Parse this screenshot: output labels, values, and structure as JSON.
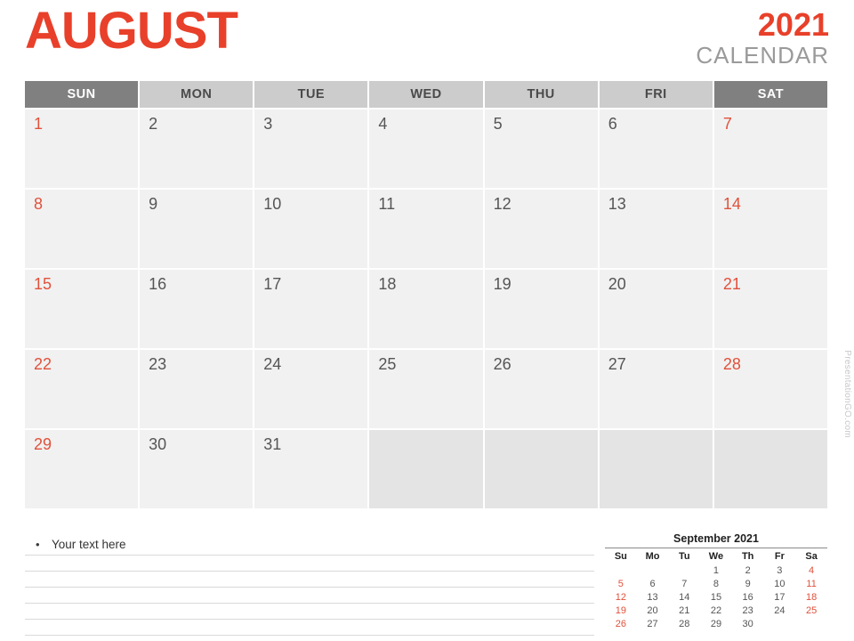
{
  "header": {
    "month": "AUGUST",
    "year": "2021",
    "calendar_word": "CALENDAR",
    "month_color": "#E8402A",
    "year_color": "#E8402A",
    "calendar_word_color": "#9A9A9A"
  },
  "colors": {
    "accent_red": "#E8402A",
    "date_red": "#E0513B",
    "header_weekend_bg": "#808080",
    "header_weekday_bg": "#CCCCCC",
    "day_cell_bg": "#F1F1F1",
    "empty_cell_bg": "#E4E4E4",
    "day_num": "#555555"
  },
  "weekdays": [
    {
      "label": "SUN",
      "weekend": true
    },
    {
      "label": "MON",
      "weekend": false
    },
    {
      "label": "TUE",
      "weekend": false
    },
    {
      "label": "WED",
      "weekend": false
    },
    {
      "label": "THU",
      "weekend": false
    },
    {
      "label": "FRI",
      "weekend": false
    },
    {
      "label": "SAT",
      "weekend": true
    }
  ],
  "weeks": [
    [
      {
        "day": "1",
        "weekend": true
      },
      {
        "day": "2",
        "weekend": false
      },
      {
        "day": "3",
        "weekend": false
      },
      {
        "day": "4",
        "weekend": false
      },
      {
        "day": "5",
        "weekend": false
      },
      {
        "day": "6",
        "weekend": false
      },
      {
        "day": "7",
        "weekend": true
      }
    ],
    [
      {
        "day": "8",
        "weekend": true
      },
      {
        "day": "9",
        "weekend": false
      },
      {
        "day": "10",
        "weekend": false
      },
      {
        "day": "11",
        "weekend": false
      },
      {
        "day": "12",
        "weekend": false
      },
      {
        "day": "13",
        "weekend": false
      },
      {
        "day": "14",
        "weekend": true
      }
    ],
    [
      {
        "day": "15",
        "weekend": true
      },
      {
        "day": "16",
        "weekend": false
      },
      {
        "day": "17",
        "weekend": false
      },
      {
        "day": "18",
        "weekend": false
      },
      {
        "day": "19",
        "weekend": false
      },
      {
        "day": "20",
        "weekend": false
      },
      {
        "day": "21",
        "weekend": true
      }
    ],
    [
      {
        "day": "22",
        "weekend": true
      },
      {
        "day": "23",
        "weekend": false
      },
      {
        "day": "24",
        "weekend": false
      },
      {
        "day": "25",
        "weekend": false
      },
      {
        "day": "26",
        "weekend": false
      },
      {
        "day": "27",
        "weekend": false
      },
      {
        "day": "28",
        "weekend": true
      }
    ],
    [
      {
        "day": "29",
        "weekend": true
      },
      {
        "day": "30",
        "weekend": false
      },
      {
        "day": "31",
        "weekend": false
      },
      {
        "day": "",
        "weekend": false
      },
      {
        "day": "",
        "weekend": false
      },
      {
        "day": "",
        "weekend": false
      },
      {
        "day": "",
        "weekend": true
      }
    ]
  ],
  "notes": {
    "bullet": "•",
    "text": "Your text here",
    "line_count": 6
  },
  "mini_calendar": {
    "title": "September 2021",
    "weekdays": [
      {
        "label": "Su",
        "weekend": true
      },
      {
        "label": "Mo",
        "weekend": false
      },
      {
        "label": "Tu",
        "weekend": false
      },
      {
        "label": "We",
        "weekend": false
      },
      {
        "label": "Th",
        "weekend": false
      },
      {
        "label": "Fr",
        "weekend": false
      },
      {
        "label": "Sa",
        "weekend": true
      }
    ],
    "weeks": [
      [
        "",
        "",
        "",
        "1",
        "2",
        "3",
        "4"
      ],
      [
        "5",
        "6",
        "7",
        "8",
        "9",
        "10",
        "11"
      ],
      [
        "12",
        "13",
        "14",
        "15",
        "16",
        "17",
        "18"
      ],
      [
        "19",
        "20",
        "21",
        "22",
        "23",
        "24",
        "25"
      ],
      [
        "26",
        "27",
        "28",
        "29",
        "30",
        "",
        ""
      ]
    ]
  },
  "watermark": {
    "text": "PresentationGO.com"
  }
}
